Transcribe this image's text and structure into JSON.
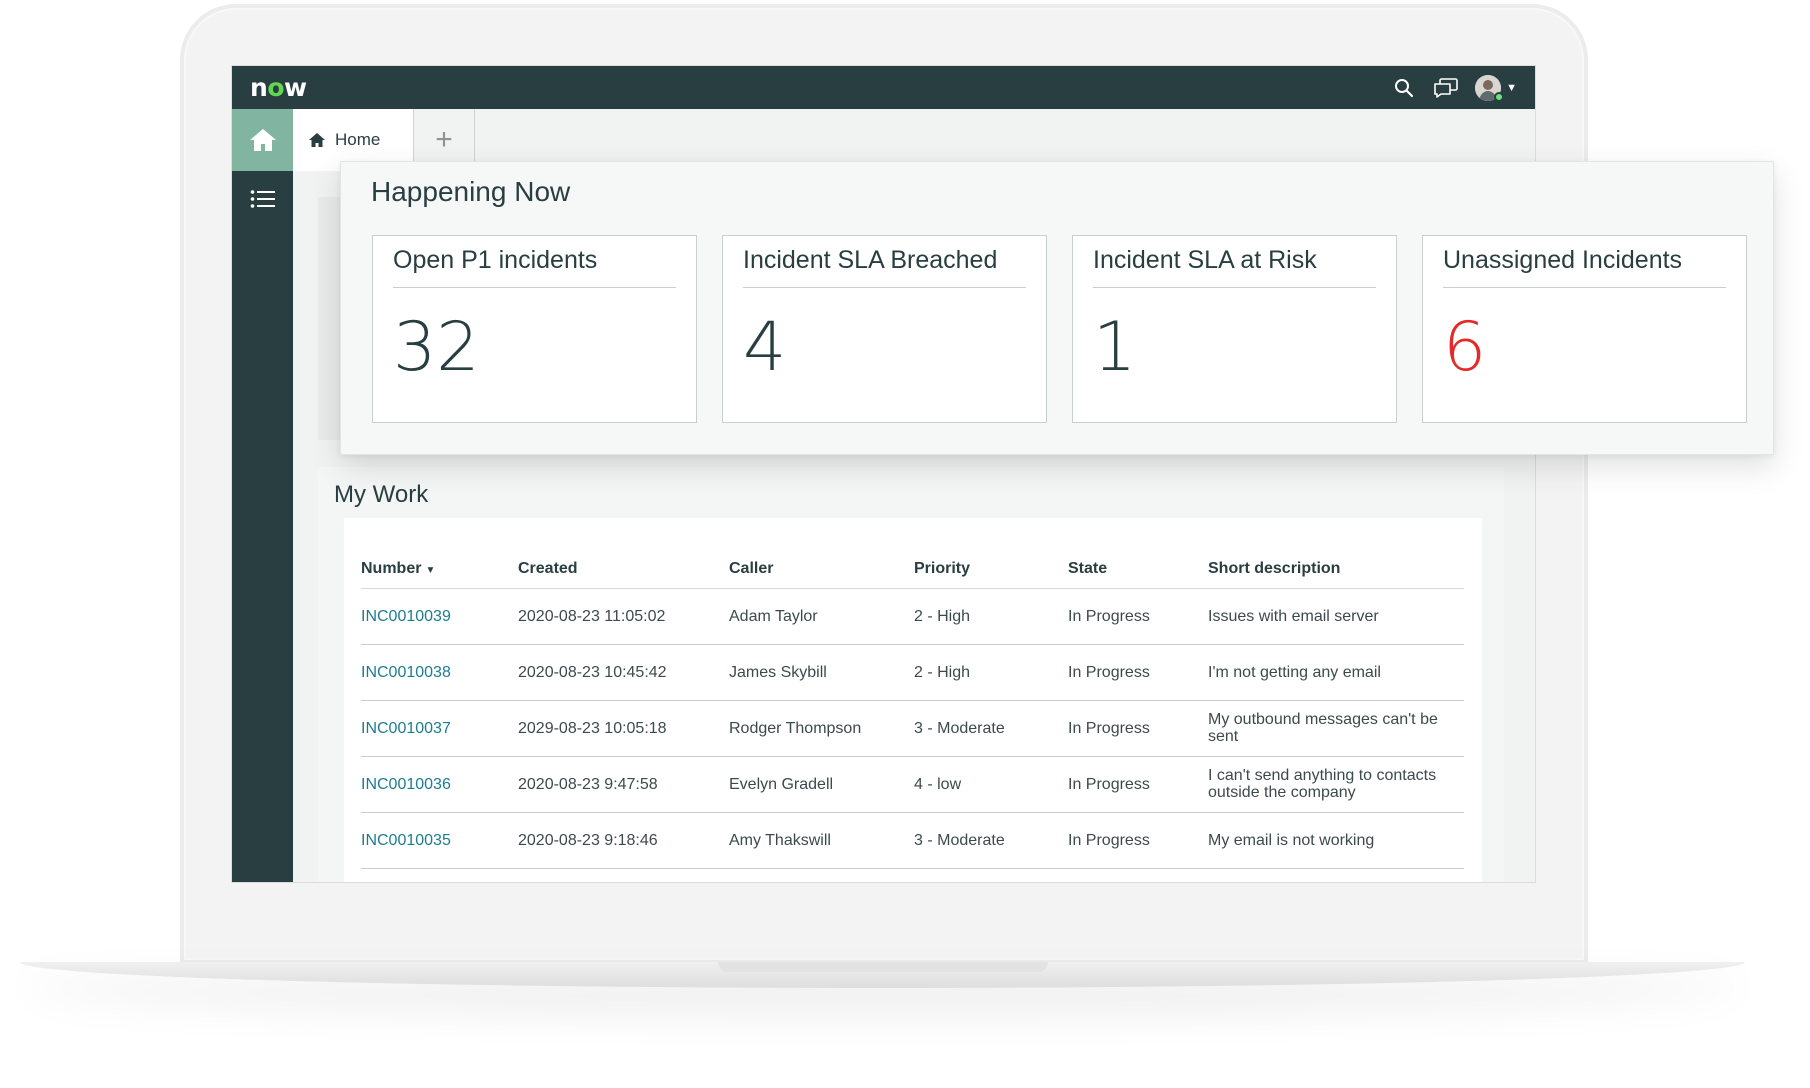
{
  "app": {
    "logo_text_n": "n",
    "logo_text_o": "o",
    "logo_text_w": "w",
    "topbar_icons": [
      "search-icon",
      "chat-icon",
      "avatar-icon"
    ]
  },
  "tabs": {
    "home_label": "Home",
    "add_label": "+"
  },
  "happening_now": {
    "title": "Happening Now",
    "tiles": [
      {
        "label": "Open P1 incidents",
        "value": "32",
        "color": "#293e40"
      },
      {
        "label": "Incident SLA Breached",
        "value": "4",
        "color": "#293e40"
      },
      {
        "label": "Incident SLA at Risk",
        "value": "1",
        "color": "#293e40"
      },
      {
        "label": "Unassigned Incidents",
        "value": "6",
        "color": "#e52828"
      }
    ]
  },
  "my_work": {
    "title": "My Work",
    "columns": [
      "Number",
      "Created",
      "Caller",
      "Priority",
      "State",
      "Short description"
    ],
    "rows": [
      {
        "number": "INC0010039",
        "created": "2020-08-23 11:05:02",
        "caller": "Adam Taylor",
        "priority": "2 - High",
        "state": "In Progress",
        "description": "Issues with email server"
      },
      {
        "number": "INC0010038",
        "created": "2020-08-23 10:45:42",
        "caller": "James Skybill",
        "priority": "2 - High",
        "state": "In Progress",
        "description": "I'm not getting any email"
      },
      {
        "number": "INC0010037",
        "created": "2029-08-23 10:05:18",
        "caller": "Rodger Thompson",
        "priority": "3 - Moderate",
        "state": "In Progress",
        "description": "My outbound messages can't be sent"
      },
      {
        "number": "INC0010036",
        "created": "2020-08-23 9:47:58",
        "caller": "Evelyn Gradell",
        "priority": "4 - low",
        "state": "In Progress",
        "description": "I can't send anything to contacts outside the company"
      },
      {
        "number": "INC0010035",
        "created": "2020-08-23 9:18:46",
        "caller": "Amy Thakswill",
        "priority": "3 - Moderate",
        "state": "In Progress",
        "description": "My email is not working"
      }
    ]
  },
  "colors": {
    "header": "#293e40",
    "accent": "#81b5a1",
    "link": "#1c7d90",
    "alert": "#e52828",
    "presence": "#71e279"
  }
}
